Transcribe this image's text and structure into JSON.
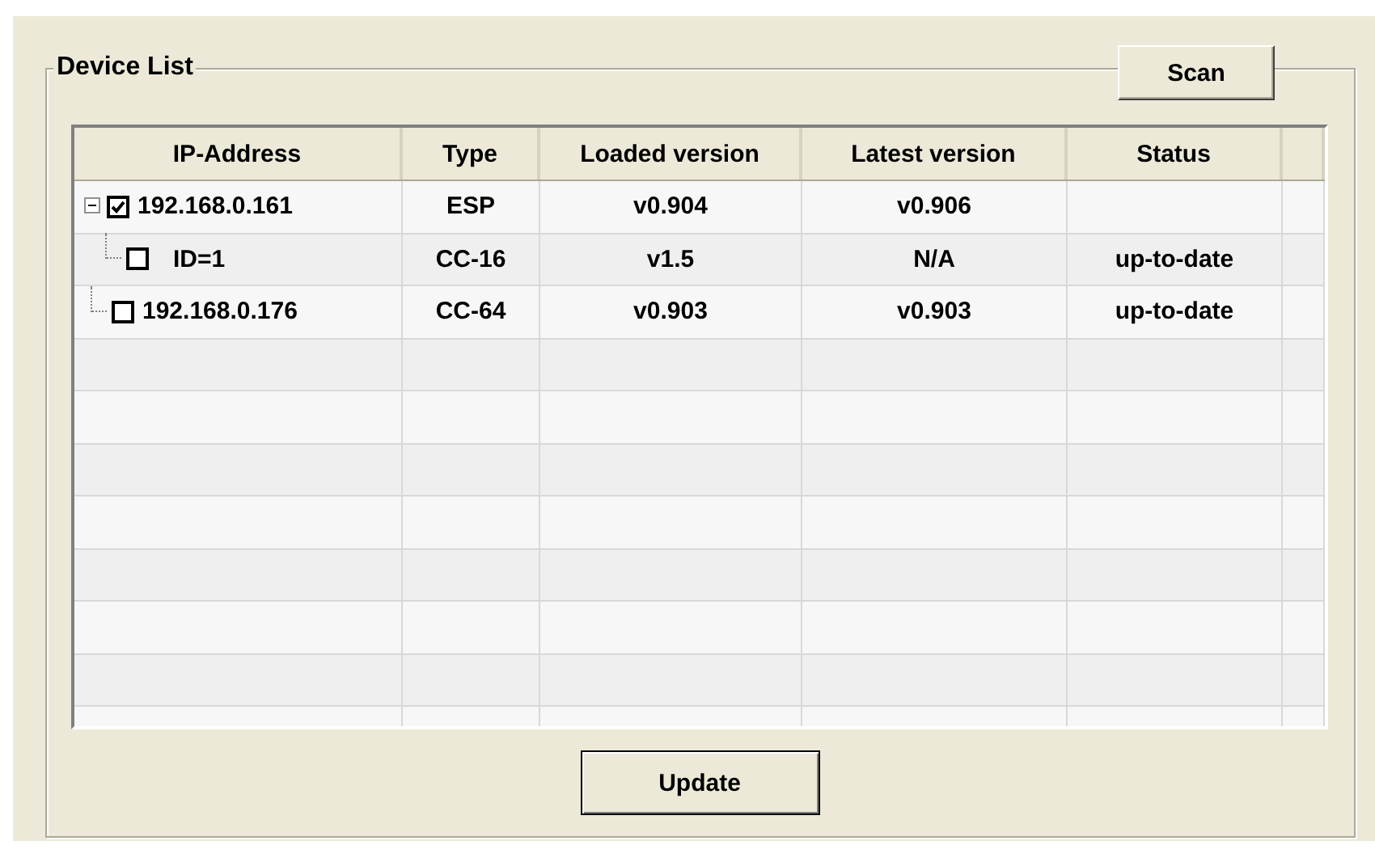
{
  "group": {
    "title": "Device List"
  },
  "scan_button": "Scan",
  "table": {
    "columns": [
      "IP-Address",
      "Type",
      "Loaded version",
      "Latest version",
      "Status"
    ],
    "rows": [
      {
        "ip": "192.168.0.161",
        "checked": true,
        "expanded": true,
        "type": "ESP",
        "loaded": "v0.904",
        "latest": "v0.906",
        "status": "",
        "children": [
          {
            "ip": "ID=1",
            "checked": false,
            "type": "CC-16",
            "loaded": "v1.5",
            "latest": "N/A",
            "status": "up-to-date"
          }
        ]
      },
      {
        "ip": "192.168.0.176",
        "checked": false,
        "type": "CC-64",
        "loaded": "v0.903",
        "latest": "v0.903",
        "status": "up-to-date"
      }
    ]
  },
  "update_button": "Update"
}
